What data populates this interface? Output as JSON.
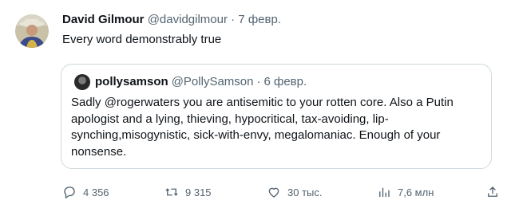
{
  "post": {
    "author_name": "David Gilmour",
    "author_handle": "@davidgilmour",
    "separator": "·",
    "date": "7 февр.",
    "text": "Every word demonstrably true"
  },
  "quote": {
    "author_name": "pollysamson",
    "author_handle": "@PollySamson",
    "separator": "·",
    "date": "6 февр.",
    "text": "Sadly @rogerwaters you are antisemitic to your rotten core. Also a Putin apologist and a lying, thieving, hypocritical, tax-avoiding, lip-synching,misogynistic, sick-with-envy, megalomaniac. Enough of your nonsense."
  },
  "actions": {
    "replies": "4 356",
    "reposts": "9 315",
    "likes": "30 тыс.",
    "views": "7,6 млн"
  },
  "icons": {
    "reply": "reply-icon",
    "repost": "repost-icon",
    "like": "heart-icon",
    "views": "views-icon",
    "share": "share-icon"
  },
  "colors": {
    "text": "#0f1419",
    "secondary": "#536471",
    "border": "#cfd9de"
  }
}
